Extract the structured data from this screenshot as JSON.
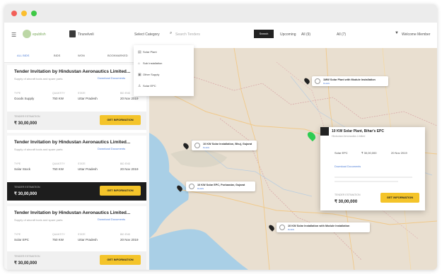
{
  "window": {
    "dots": [
      "#f25f58",
      "#fbbe2e",
      "#3ec946"
    ]
  },
  "topbar": {
    "logo_text": "epublish",
    "location": "Tirunelveli",
    "category_select": "Select Category",
    "search_placeholder": "Search Tenders",
    "search_button": "Search",
    "filter_label": "Upcoming",
    "filter_a": "All (9)",
    "filter_b": "All (7)",
    "user_name": "Welcome Member"
  },
  "tabs": [
    "ALL BIDS",
    "BIDS",
    "WON",
    "BOOKMARKED"
  ],
  "cards": [
    {
      "title": "Tender Invitation by Hindustan Aeronautics Limited...",
      "sub": "Supply of aircraft tools and spare parts",
      "link": "Download Documents",
      "meta_labels": [
        "TYPE",
        "QUANTITY",
        "STATE",
        "BID END"
      ],
      "meta_values": [
        "Goods Supply",
        "750 KW",
        "Uttar Pradesh",
        "20 Nov 2019"
      ],
      "value_label": "TENDER ESTIMATION",
      "value_amount": "₹ 30,00,000",
      "button": "GET INFORMATION"
    },
    {
      "title": "Tender Invitation by Hindustan Aeronautics Limited...",
      "sub": "Supply of aircraft tools and spare parts",
      "link": "Download Documents",
      "meta_labels": [
        "TYPE",
        "QUANTITY",
        "STATE",
        "BID END"
      ],
      "meta_values": [
        "Solar Stock",
        "750 KW",
        "Uttar Pradesh",
        "20 Nov 2019"
      ],
      "value_label": "TENDER ESTIMATION",
      "value_amount": "₹ 30,00,000",
      "button": "GET INFORMATION"
    },
    {
      "title": "Tender Invitation by Hindustan Aeronautics Limited...",
      "sub": "Supply of aircraft tools and spare parts",
      "link": "Download Documents",
      "meta_labels": [
        "TYPE",
        "QUANTITY",
        "STATE",
        "BID END"
      ],
      "meta_values": [
        "Solar EPC",
        "750 KW",
        "Uttar Pradesh",
        "20 Nov 2019"
      ],
      "value_label": "TENDER ESTIMATION",
      "value_amount": "₹ 30,00,000",
      "button": "GET INFORMATION"
    }
  ],
  "dropdown": {
    "items": [
      {
        "icon": "solar-panel-icon",
        "label": "Solar Plant"
      },
      {
        "icon": "substation-icon",
        "label": "Sub Installation"
      },
      {
        "icon": "supply-icon",
        "label": "Other Supply"
      },
      {
        "icon": "epc-icon",
        "label": "Solar EPC"
      }
    ]
  },
  "map_pins": [
    {
      "title": "1MW  Solar Plant with Module Installation",
      "sub": "Details",
      "color": "#222222"
    },
    {
      "title": "10 KW  Solar Installation, Bhuj, Gujarat",
      "sub": "Details",
      "color": "#222222"
    },
    {
      "title": "10 KW  Solar EPC, Porbandar, Gujarat",
      "sub": "Details",
      "color": "#222222"
    },
    {
      "title": "10 KW  Solar Installation with Module Installation",
      "sub": "Details",
      "color": "#222222"
    }
  ],
  "popup": {
    "title": "10 KW  Solar Plant, Bihar's EPC",
    "sub": "Hindustan Aeronautics Limited",
    "meta_values": [
      "Solar EPC",
      "₹ 30,00,000",
      "20 Nov 2019"
    ],
    "link": "Download Documents",
    "value_label": "TENDER ESTIMATION",
    "value_amount": "₹ 30,00,000",
    "button": "GET INFORMATION",
    "pin_color": "#2ecc52"
  }
}
